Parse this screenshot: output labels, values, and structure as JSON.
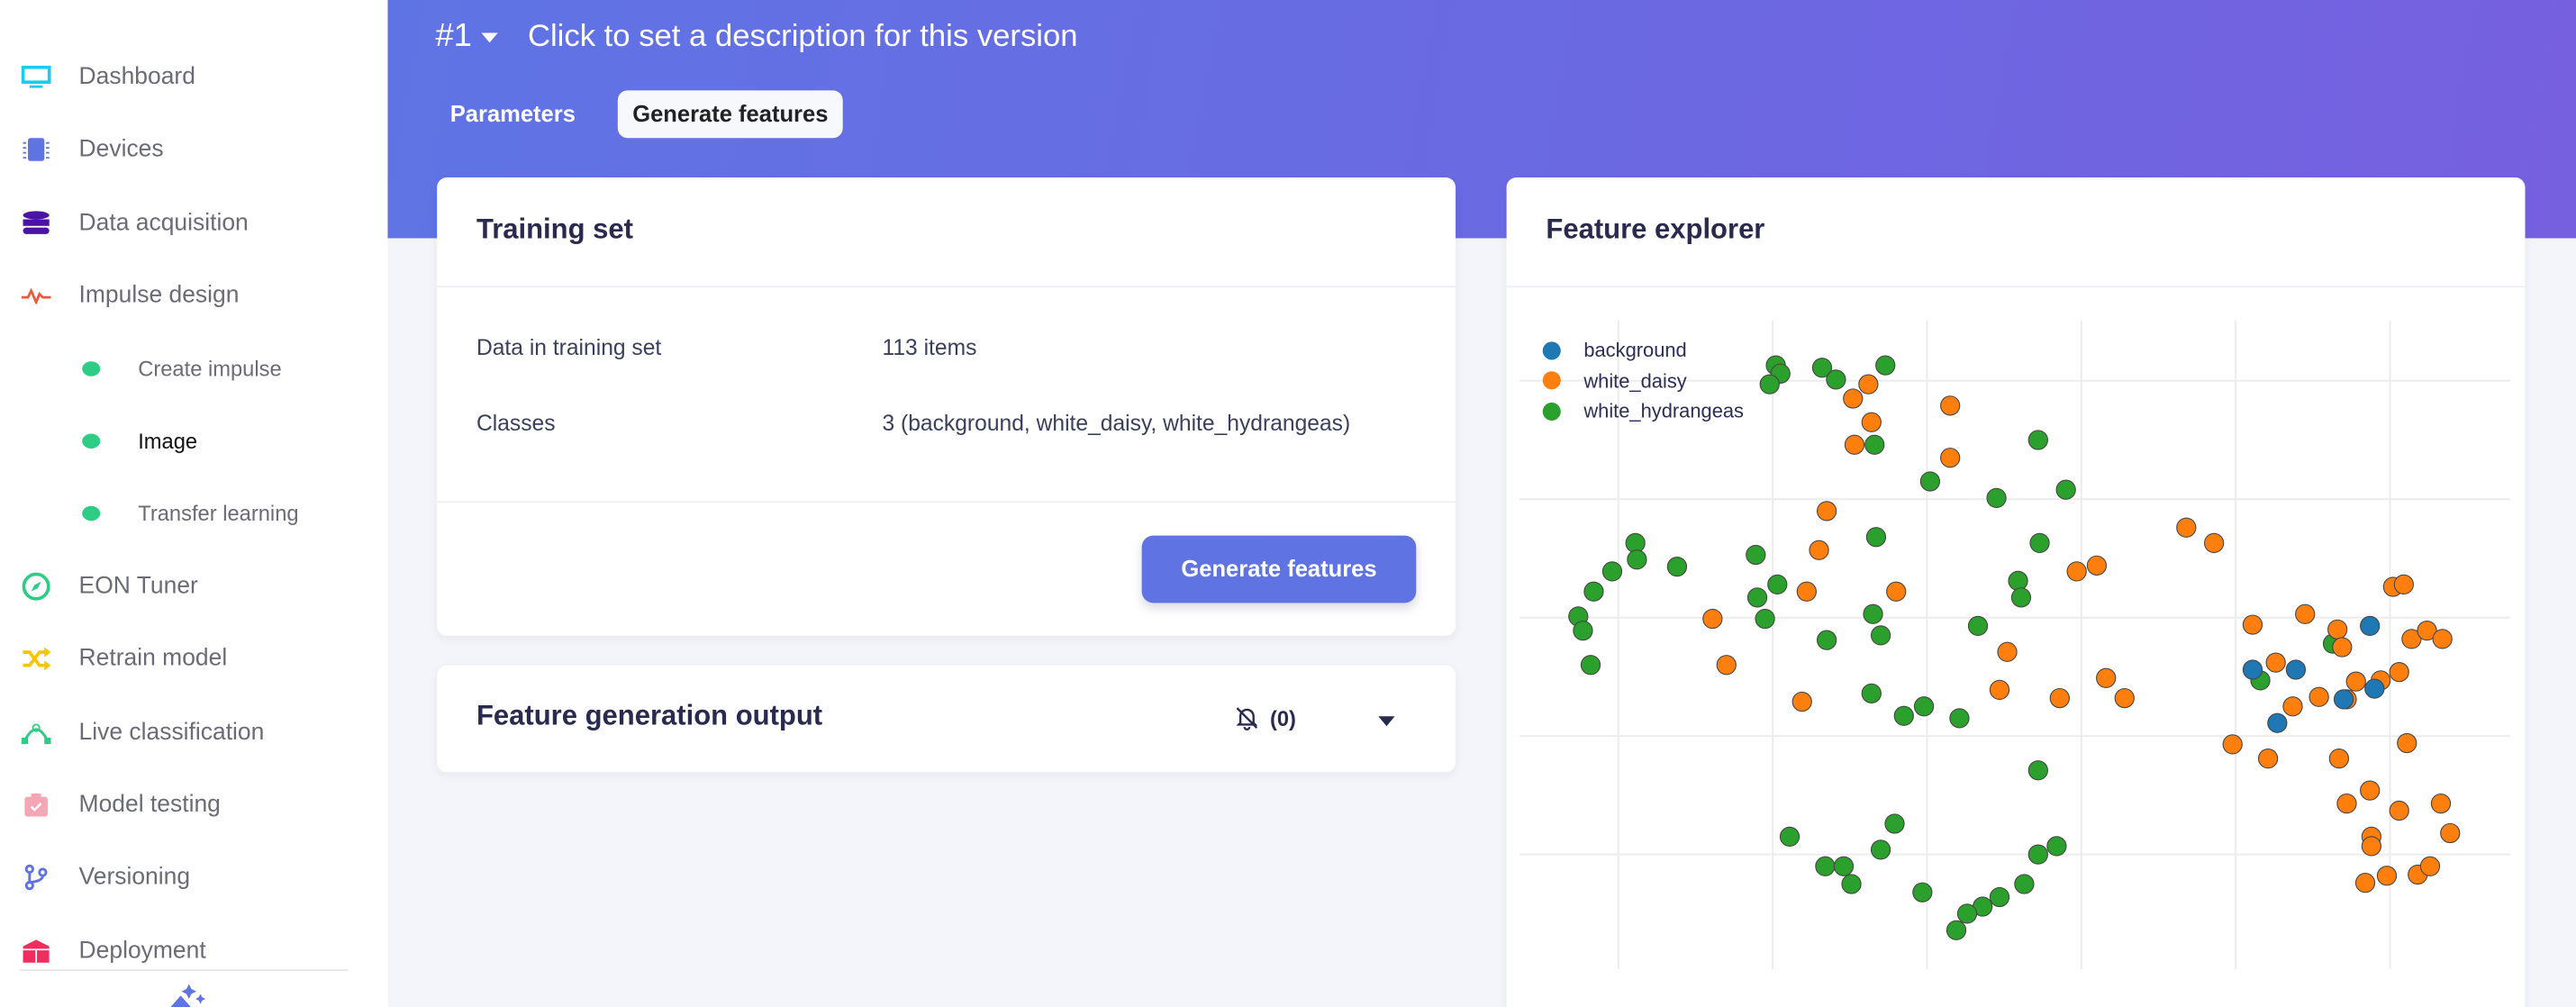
{
  "sidebar": {
    "items": [
      {
        "label": "Dashboard",
        "icon": "monitor-icon",
        "color": "#1ec8ef"
      },
      {
        "label": "Devices",
        "icon": "chip-icon",
        "color": "#5f73e2"
      },
      {
        "label": "Data acquisition",
        "icon": "database-icon",
        "color": "#4b12a6"
      },
      {
        "label": "Impulse design",
        "icon": "pulse-icon",
        "color": "#f2573a"
      },
      {
        "label": "Create impulse",
        "icon": "dot-icon",
        "color": "#2ecc85"
      },
      {
        "label": "Image",
        "icon": "dot-icon",
        "color": "#2ecc85"
      },
      {
        "label": "Transfer learning",
        "icon": "dot-icon",
        "color": "#2ecc85"
      },
      {
        "label": "EON Tuner",
        "icon": "compass-icon",
        "color": "#2ecc85"
      },
      {
        "label": "Retrain model",
        "icon": "shuffle-icon",
        "color": "#f7c600"
      },
      {
        "label": "Live classification",
        "icon": "bezier-icon",
        "color": "#2ecc85"
      },
      {
        "label": "Model testing",
        "icon": "clipboard-check-icon",
        "color": "#f6a5b5"
      },
      {
        "label": "Versioning",
        "icon": "branch-icon",
        "color": "#5f73e2"
      },
      {
        "label": "Deployment",
        "icon": "box-icon",
        "color": "#ef2d5e"
      }
    ],
    "active": "Image"
  },
  "header": {
    "version": "#1",
    "description": "Click to set a description for this version",
    "tabs": [
      {
        "label": "Parameters",
        "selected": false
      },
      {
        "label": "Generate features",
        "selected": true
      }
    ],
    "gradient": [
      "#5f74e4",
      "#7660e0"
    ]
  },
  "training_set": {
    "title": "Training set",
    "rows": [
      {
        "label": "Data in training set",
        "value": "113 items"
      },
      {
        "label": "Classes",
        "value": "3 (background, white_daisy, white_hydrangeas)"
      }
    ],
    "button": "Generate features",
    "accent": "#5f73e2"
  },
  "feature_output": {
    "title": "Feature generation output",
    "notifications": "(0)"
  },
  "feature_explorer": {
    "title": "Feature explorer"
  },
  "chart_data": {
    "type": "scatter",
    "title": "",
    "xlabel": "",
    "ylabel": "",
    "xlim": [
      -0.64,
      5.78
    ],
    "ylim": [
      -2.97,
      2.51
    ],
    "x_gridlines": [
      0,
      1,
      2,
      3,
      4,
      5
    ],
    "y_gridlines": [
      -2,
      -1,
      0,
      1,
      2
    ],
    "grid": true,
    "tick_labels": false,
    "legend": "top-left",
    "series": [
      {
        "name": "background",
        "color": "#1f77b4",
        "points": [
          [
            4.87,
            -0.07
          ],
          [
            4.11,
            -0.44
          ],
          [
            4.39,
            -0.44
          ],
          [
            4.9,
            -0.6
          ],
          [
            4.27,
            -0.89
          ],
          [
            4.7,
            -0.69
          ]
        ]
      },
      {
        "name": "white_daisy",
        "color": "#ff7f0e",
        "points": [
          [
            1.52,
            1.85
          ],
          [
            1.62,
            1.97
          ],
          [
            2.15,
            1.79
          ],
          [
            1.64,
            1.65
          ],
          [
            1.53,
            1.46
          ],
          [
            2.15,
            1.35
          ],
          [
            1.35,
            0.9
          ],
          [
            1.3,
            0.57
          ],
          [
            1.22,
            0.22
          ],
          [
            1.8,
            0.22
          ],
          [
            0.61,
            -0.01
          ],
          [
            0.7,
            -0.4
          ],
          [
            1.19,
            -0.71
          ],
          [
            2.52,
            -0.29
          ],
          [
            2.47,
            -0.61
          ],
          [
            2.86,
            -0.68
          ],
          [
            3.16,
            -0.51
          ],
          [
            3.28,
            -0.68
          ],
          [
            2.97,
            0.39
          ],
          [
            3.1,
            0.44
          ],
          [
            3.68,
            0.76
          ],
          [
            3.86,
            0.63
          ],
          [
            4.11,
            -0.06
          ],
          [
            4.45,
            0.03
          ],
          [
            4.66,
            -0.1
          ],
          [
            4.69,
            -0.25
          ],
          [
            5.02,
            0.26
          ],
          [
            5.09,
            0.28
          ],
          [
            5.14,
            -0.18
          ],
          [
            5.24,
            -0.11
          ],
          [
            5.34,
            -0.18
          ],
          [
            4.26,
            -0.38
          ],
          [
            4.54,
            -0.67
          ],
          [
            4.78,
            -0.54
          ],
          [
            4.94,
            -0.53
          ],
          [
            5.06,
            -0.46
          ],
          [
            4.72,
            -0.69
          ],
          [
            4.37,
            -0.75
          ],
          [
            3.98,
            -1.07
          ],
          [
            4.21,
            -1.19
          ],
          [
            4.67,
            -1.19
          ],
          [
            5.11,
            -1.06
          ],
          [
            4.87,
            -1.46
          ],
          [
            4.72,
            -1.57
          ],
          [
            5.06,
            -1.63
          ],
          [
            5.33,
            -1.57
          ],
          [
            5.39,
            -1.82
          ],
          [
            4.88,
            -1.85
          ],
          [
            4.88,
            -1.93
          ],
          [
            4.84,
            -2.24
          ],
          [
            4.98,
            -2.18
          ],
          [
            5.18,
            -2.17
          ],
          [
            5.26,
            -2.1
          ]
        ]
      },
      {
        "name": "white_hydrangeas",
        "color": "#2ca02c",
        "points": [
          [
            1.02,
            2.13
          ],
          [
            1.05,
            2.06
          ],
          [
            0.98,
            1.97
          ],
          [
            1.32,
            2.11
          ],
          [
            1.41,
            2.01
          ],
          [
            1.73,
            2.13
          ],
          [
            1.66,
            1.46
          ],
          [
            2.72,
            1.5
          ],
          [
            2.02,
            1.15
          ],
          [
            2.45,
            1.01
          ],
          [
            2.9,
            1.08
          ],
          [
            1.67,
            0.68
          ],
          [
            2.73,
            0.63
          ],
          [
            0.11,
            0.63
          ],
          [
            0.12,
            0.49
          ],
          [
            -0.04,
            0.39
          ],
          [
            -0.16,
            0.22
          ],
          [
            -0.26,
            0.01
          ],
          [
            -0.23,
            -0.11
          ],
          [
            -0.18,
            -0.4
          ],
          [
            0.38,
            0.43
          ],
          [
            0.89,
            0.53
          ],
          [
            1.03,
            0.28
          ],
          [
            0.9,
            0.17
          ],
          [
            0.95,
            -0.01
          ],
          [
            1.35,
            -0.19
          ],
          [
            1.65,
            0.03
          ],
          [
            1.7,
            -0.15
          ],
          [
            2.59,
            0.31
          ],
          [
            2.61,
            0.17
          ],
          [
            2.33,
            -0.07
          ],
          [
            1.64,
            -0.64
          ],
          [
            1.85,
            -0.83
          ],
          [
            1.98,
            -0.75
          ],
          [
            2.21,
            -0.85
          ],
          [
            4.63,
            -0.22
          ],
          [
            4.16,
            -0.53
          ],
          [
            2.72,
            -1.29
          ],
          [
            1.11,
            -1.85
          ],
          [
            1.79,
            -1.74
          ],
          [
            1.7,
            -1.96
          ],
          [
            1.34,
            -2.1
          ],
          [
            1.46,
            -2.1
          ],
          [
            1.51,
            -2.25
          ],
          [
            1.97,
            -2.32
          ],
          [
            2.72,
            -2.0
          ],
          [
            2.84,
            -1.93
          ],
          [
            2.63,
            -2.25
          ],
          [
            2.47,
            -2.36
          ],
          [
            2.36,
            -2.44
          ],
          [
            2.26,
            -2.5
          ],
          [
            2.19,
            -2.64
          ]
        ]
      }
    ]
  }
}
